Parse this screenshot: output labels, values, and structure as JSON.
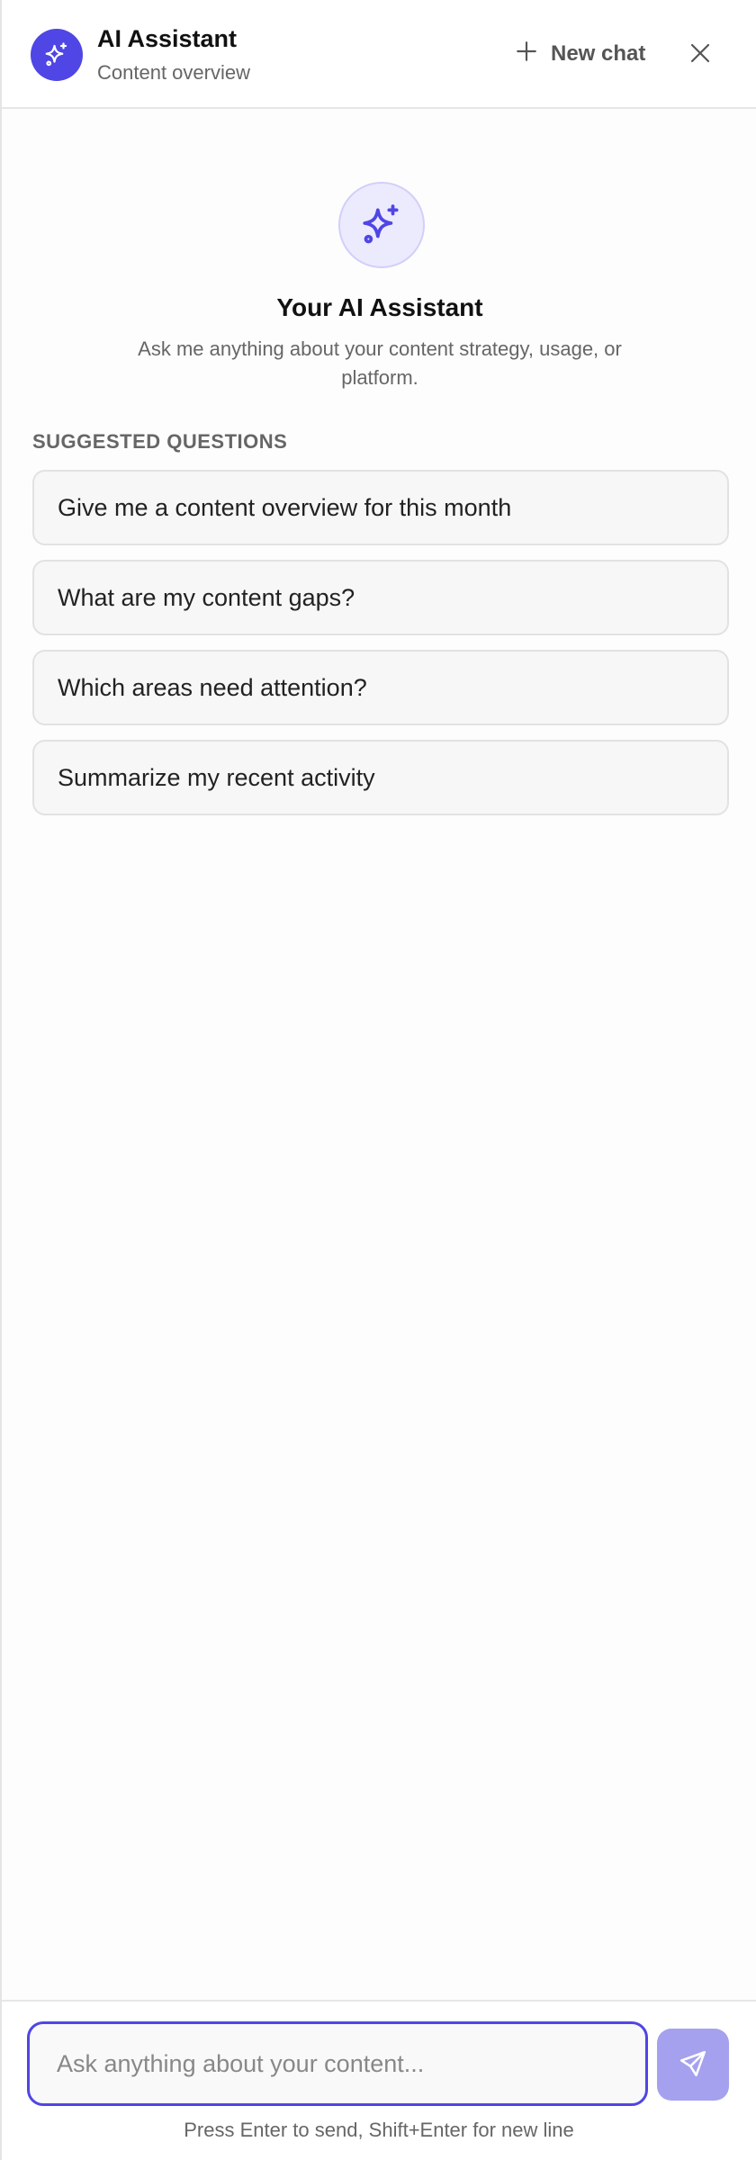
{
  "header": {
    "title": "AI Assistant",
    "subtitle": "Content overview",
    "new_chat_label": "New chat",
    "icons": {
      "brand": "sparkles-icon",
      "new_chat": "plus-icon",
      "close": "close-icon"
    }
  },
  "hero": {
    "icon": "sparkles-icon",
    "title": "Your AI Assistant",
    "description": "Ask me anything about your content strategy, usage, or platform."
  },
  "suggestions": {
    "label": "SUGGESTED QUESTIONS",
    "items": [
      "Give me a content overview for this month",
      "What are my content gaps?",
      "Which areas need attention?",
      "Summarize my recent activity"
    ]
  },
  "composer": {
    "placeholder": "Ask anything about your content...",
    "value": "",
    "send_icon": "send-icon",
    "hint": "Press Enter to send, Shift+Enter for new line"
  },
  "colors": {
    "accent": "#4f46e5",
    "accent_soft": "#ecebfd",
    "send_disabled": "#a5a1ee"
  }
}
